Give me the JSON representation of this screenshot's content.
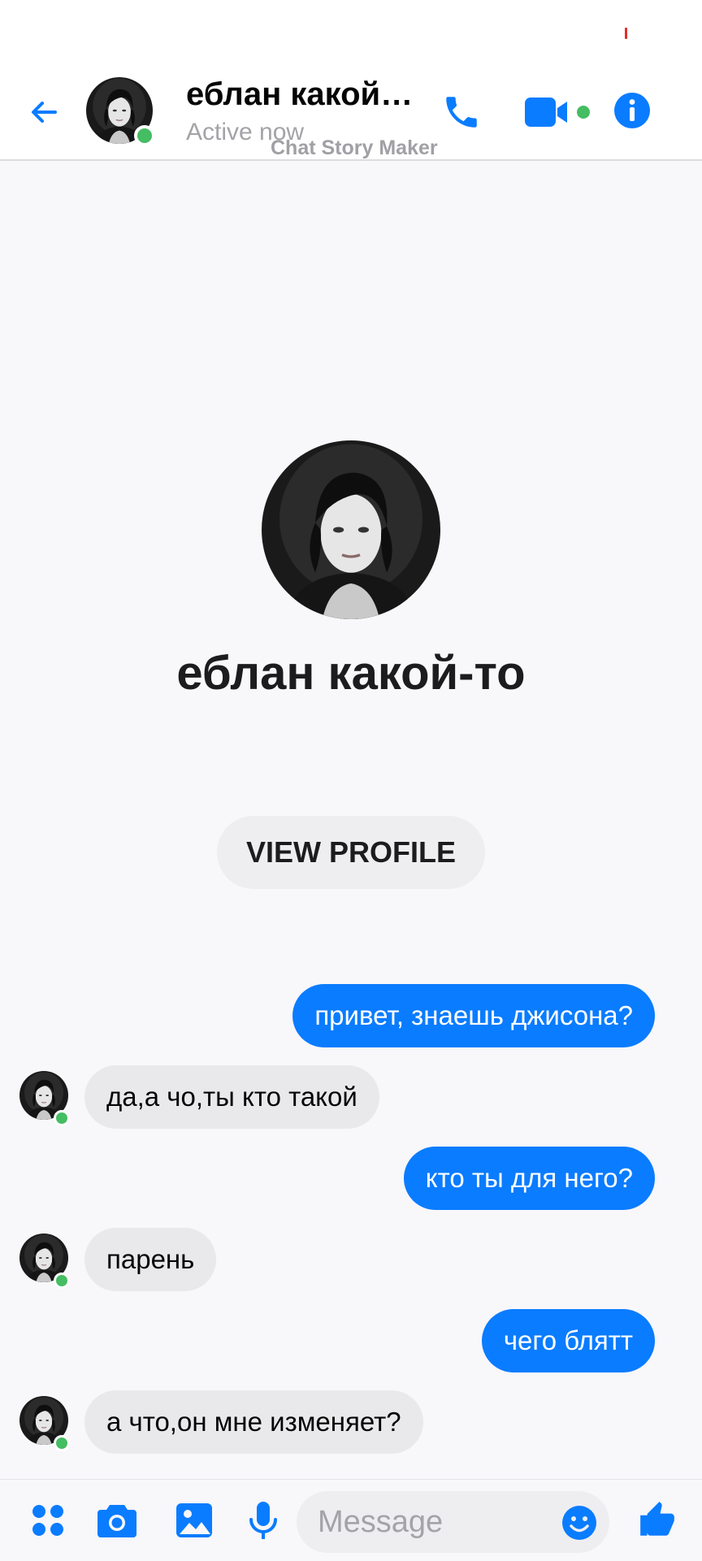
{
  "header": {
    "contact_name": "еблан какой-то",
    "status": "Active now",
    "watermark": "Chat Story Maker"
  },
  "profile": {
    "name": "еблан какой-то",
    "view_profile_label": "VIEW PROFILE"
  },
  "messages": [
    {
      "side": "out",
      "text": "привет, знаешь джисона?"
    },
    {
      "side": "in",
      "text": "да,а чо,ты кто такой"
    },
    {
      "side": "out",
      "text": "кто ты для него?"
    },
    {
      "side": "in",
      "text": "парень"
    },
    {
      "side": "out",
      "text": "чего блятт"
    },
    {
      "side": "in",
      "text": "а что,он мне изменяет?"
    }
  ],
  "composer": {
    "placeholder": "Message"
  },
  "colors": {
    "accent": "#0a7cff",
    "online": "#45bd62",
    "incoming_bubble": "#e9e9eb",
    "background": "#f8f7fa"
  },
  "icons": [
    "back-arrow-icon",
    "phone-icon",
    "video-camera-icon",
    "info-icon",
    "apps-icon",
    "camera-icon",
    "gallery-icon",
    "microphone-icon",
    "emoji-icon",
    "thumbs-up-icon"
  ]
}
